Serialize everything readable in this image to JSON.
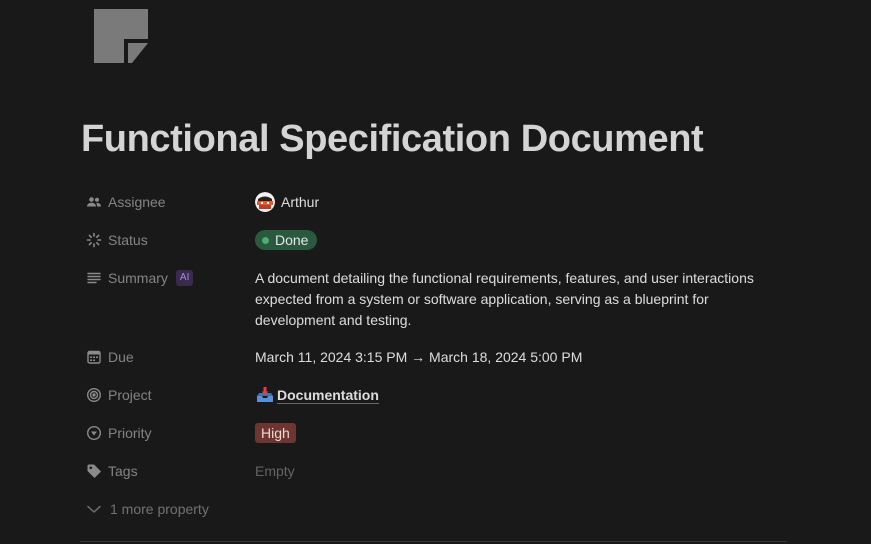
{
  "page": {
    "icon": "document-icon",
    "title": "Functional Specification Document"
  },
  "properties": {
    "assignee": {
      "label": "Assignee",
      "icon": "people-icon",
      "value": "Arthur"
    },
    "status": {
      "label": "Status",
      "icon": "status-spinner-icon",
      "value": "Done",
      "color": "#2b593f",
      "dot_color": "#4dab73"
    },
    "summary": {
      "label": "Summary",
      "icon": "text-lines-icon",
      "badge": "AI",
      "value": "A document detailing the functional requirements, features, and user interactions expected from a system or software application, serving as a blueprint for development and testing."
    },
    "due": {
      "label": "Due",
      "icon": "calendar-icon",
      "value": "March 11, 2024 3:15 PM → March 18, 2024 5:00 PM"
    },
    "project": {
      "label": "Project",
      "icon": "target-icon",
      "value": "Documentation",
      "emoji": "inbox-tray-icon"
    },
    "priority": {
      "label": "Priority",
      "icon": "priority-icon",
      "value": "High",
      "color": "#6e3630"
    },
    "tags": {
      "label": "Tags",
      "icon": "tag-icon",
      "value": "Empty"
    }
  },
  "more_properties": {
    "label": "1 more property",
    "icon": "chevron-down-icon"
  }
}
